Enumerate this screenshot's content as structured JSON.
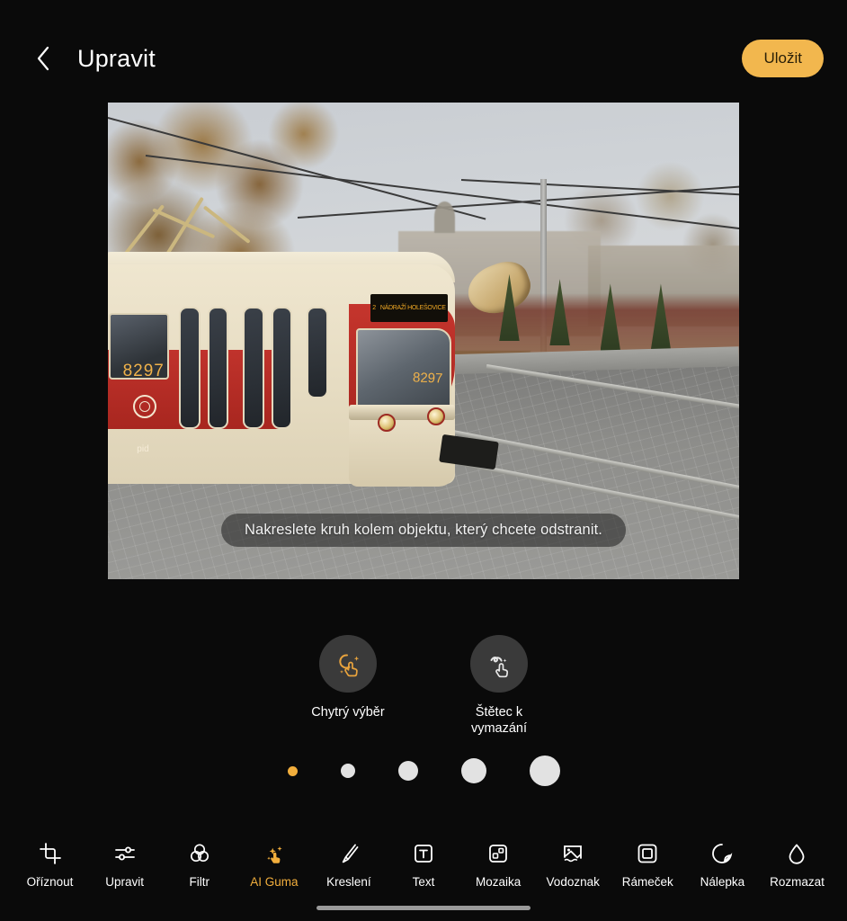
{
  "header": {
    "back_icon": "chevron-left-icon",
    "title": "Upravit",
    "save_label": "Uložit",
    "save_color": "#F2B74E"
  },
  "photo": {
    "hint_text": "Nakreslete kruh kolem objektu, který chcete odstranit.",
    "subject": "vintage cream and red Prague tram number 8297 at a Christmas market",
    "tram_number_side": "8297",
    "tram_number_front": "8297",
    "tram_operator_logo": "pid",
    "tram_route_number": "2",
    "destination_text": "NÁDRAŽÍ HOLEŠOVICE"
  },
  "tool_modes": [
    {
      "label": "Chytrý výběr",
      "icon": "smart-select-icon",
      "active": true,
      "color": "#E8A33D"
    },
    {
      "label": "Štětec k\nvymazání",
      "label_line1": "Štětec k",
      "label_line2": "vymazání",
      "icon": "eraser-brush-icon",
      "active": false,
      "color": "#FFFFFF"
    }
  ],
  "brush_sizes": {
    "selected_index": 0,
    "selected_color": "#F2AE3C",
    "dot_color": "#E2E2E2",
    "sizes": [
      11,
      16,
      22,
      28,
      34
    ]
  },
  "toolbar": {
    "items": [
      {
        "label": "Oříznout",
        "icon": "crop-icon",
        "active": false
      },
      {
        "label": "Upravit",
        "icon": "sliders-icon",
        "active": false
      },
      {
        "label": "Filtr",
        "icon": "filter-circles-icon",
        "active": false
      },
      {
        "label": "AI Guma",
        "icon": "ai-eraser-hand-icon",
        "active": true
      },
      {
        "label": "Kreslení",
        "icon": "brush-icon",
        "active": false
      },
      {
        "label": "Text",
        "icon": "text-box-icon",
        "active": false
      },
      {
        "label": "Mozaika",
        "icon": "mosaic-icon",
        "active": false
      },
      {
        "label": "Vodoznak",
        "icon": "watermark-image-icon",
        "active": false
      },
      {
        "label": "Rámeček",
        "icon": "frame-icon",
        "active": false
      },
      {
        "label": "Nálepka",
        "icon": "sticker-icon",
        "active": false
      },
      {
        "label": "Rozmazat",
        "icon": "blur-drop-icon",
        "active": false
      }
    ],
    "active_color": "#F2AE3C"
  },
  "system": {
    "home_indicator": "home-indicator-bar"
  }
}
